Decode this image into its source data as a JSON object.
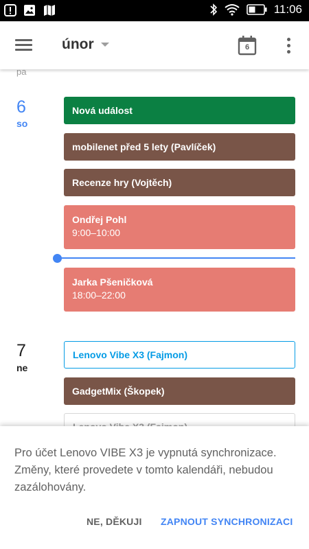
{
  "status_bar": {
    "time": "11:06",
    "left_icons": [
      "alert-icon",
      "image-icon",
      "map-icon"
    ],
    "right_icons": [
      "bluetooth-icon",
      "wifi-icon",
      "battery-icon"
    ]
  },
  "toolbar": {
    "month": "únor",
    "today_day": "6",
    "icons": [
      "menu-icon",
      "dropdown-caret-icon",
      "today-calendar-icon",
      "more-vert-icon"
    ]
  },
  "agenda": {
    "prev_day_label": "pa",
    "days": [
      {
        "num": "6",
        "name": "so",
        "is_today": true,
        "events": [
          {
            "title": "Nová událost",
            "color": "#0b8043"
          },
          {
            "title": "mobilenet před 5 lety (Pavlíček)",
            "color": "#795548"
          },
          {
            "title": "Recenze hry (Vojtěch)",
            "color": "#795548"
          },
          {
            "title": "Ondřej Pohl",
            "time": "9:00–10:00",
            "color": "#e67c73"
          },
          {
            "title": "Jarka Pšeničková",
            "time": "18:00–22:00",
            "color": "#e67c73"
          }
        ]
      },
      {
        "num": "7",
        "name": "ne",
        "is_today": false,
        "events": [
          {
            "title": "Lenovo Vibe X3 (Fajmon)",
            "color": "#039be5",
            "style": "outlined"
          },
          {
            "title": "GadgetMix (Škopek)",
            "color": "#795548"
          },
          {
            "title": "Lenovo Vibe X3 (Fajmon)",
            "color": "#d7d7d7",
            "style": "outlined"
          }
        ]
      }
    ],
    "now_indicator_color": "#4285f4"
  },
  "sync_notice": {
    "message": "Pro účet Lenovo VIBE X3 je vypnutá synchronizace. Změny, které provedete v tomto kalendáři, nebudou zazálohovány.",
    "dismiss_label": "NE, DĚKUJI",
    "enable_label": "ZAPNOUT SYNCHRONIZACI"
  },
  "colors": {
    "accent": "#4285f4",
    "today_text": "#4285f4"
  }
}
